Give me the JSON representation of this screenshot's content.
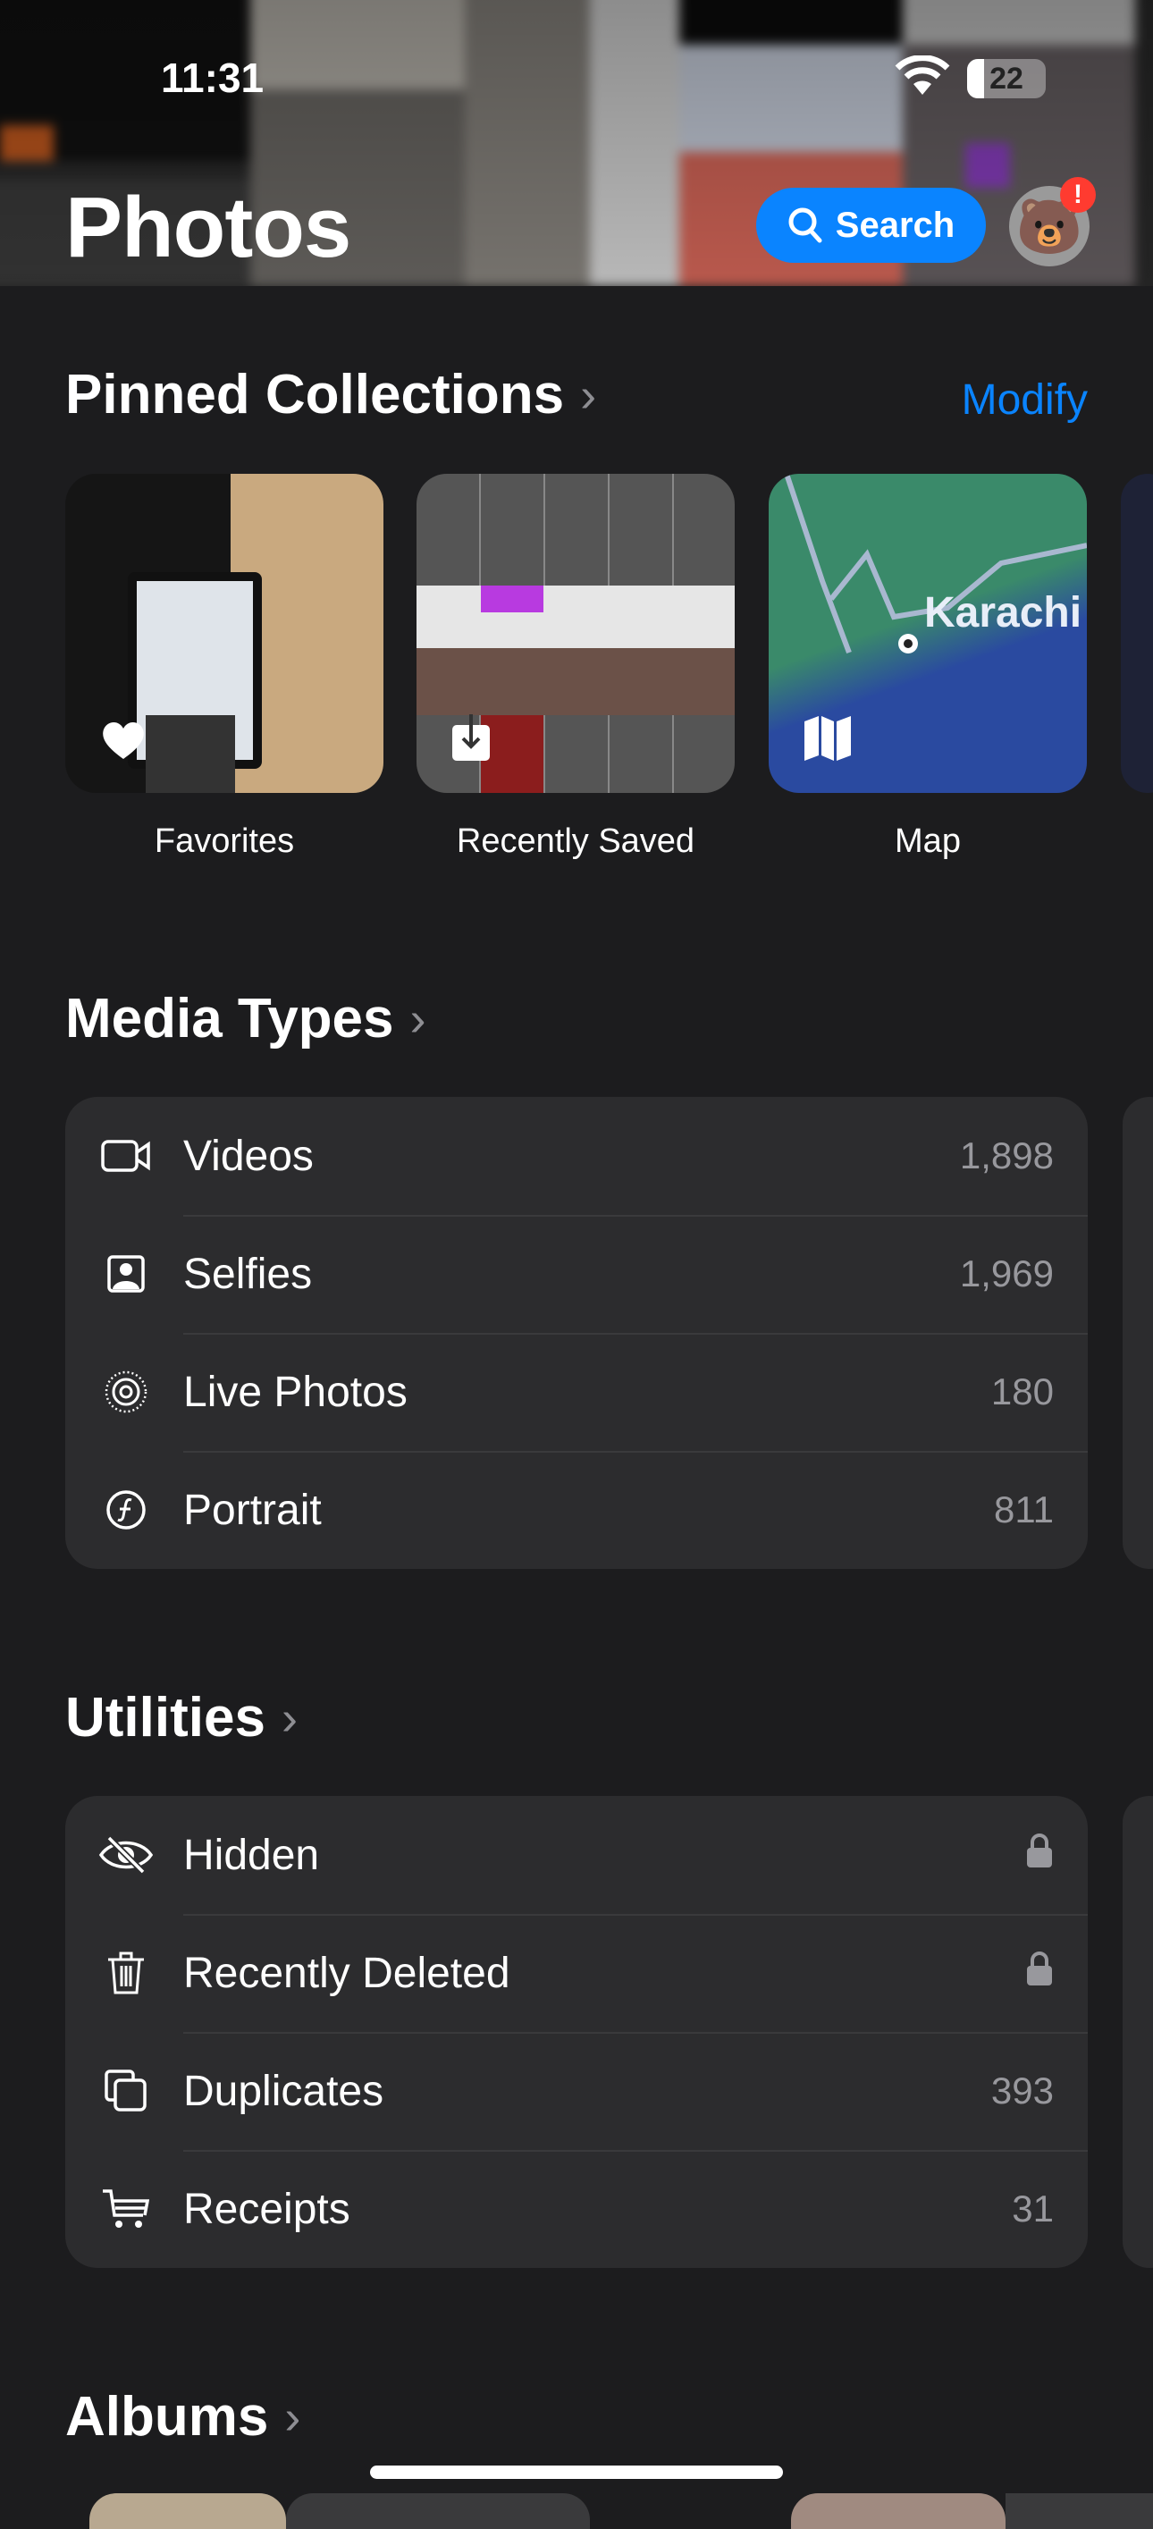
{
  "status_bar": {
    "time": "11:31",
    "battery": "22",
    "battery_level_percent": 22
  },
  "header": {
    "title": "Photos",
    "search_label": "Search",
    "avatar_badge": "!",
    "avatar_emoji": "🐻"
  },
  "pinned": {
    "title": "Pinned Collections",
    "modify": "Modify",
    "tiles": [
      {
        "label": "Favorites",
        "icon": "heart-icon"
      },
      {
        "label": "Recently Saved",
        "icon": "download-icon"
      },
      {
        "label": "Map",
        "icon": "map-icon",
        "map_label": "Karachi"
      }
    ]
  },
  "media_types": {
    "title": "Media Types",
    "items": [
      {
        "label": "Videos",
        "count": "1,898",
        "icon": "video-icon"
      },
      {
        "label": "Selfies",
        "count": "1,969",
        "icon": "selfie-icon"
      },
      {
        "label": "Live Photos",
        "count": "180",
        "icon": "live-photo-icon"
      },
      {
        "label": "Portrait",
        "count": "811",
        "icon": "portrait-icon"
      }
    ]
  },
  "utilities": {
    "title": "Utilities",
    "items": [
      {
        "label": "Hidden",
        "icon": "eye-slash-icon",
        "locked": true
      },
      {
        "label": "Recently Deleted",
        "icon": "trash-icon",
        "locked": true
      },
      {
        "label": "Duplicates",
        "count": "393",
        "icon": "duplicate-icon"
      },
      {
        "label": "Receipts",
        "count": "31",
        "icon": "cart-icon"
      }
    ]
  },
  "albums": {
    "title": "Albums"
  },
  "colors": {
    "accent": "#0a84ff",
    "background": "#1c1c1e",
    "card": "#2c2c2e",
    "badge": "#ff3b30"
  }
}
